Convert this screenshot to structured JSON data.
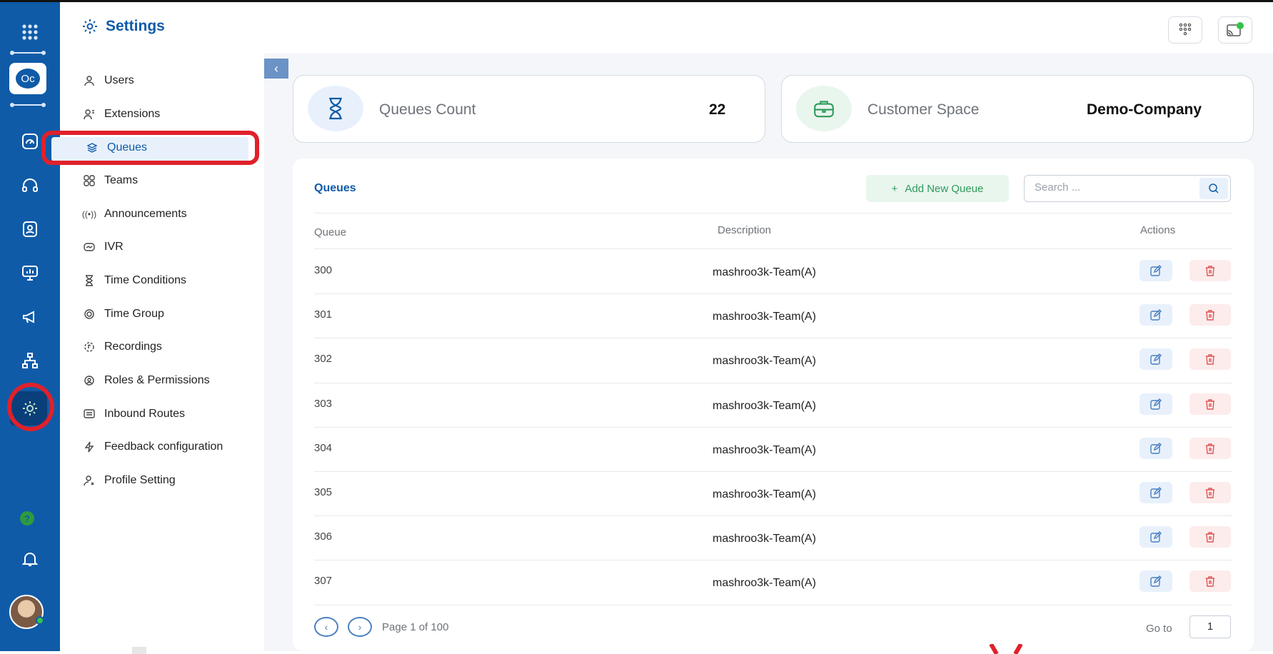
{
  "header": {
    "title": "Settings",
    "icon": "settings-cog-icon",
    "dialpad_icon": "dialpad-icon",
    "status_icon": "connection-status-icon",
    "status_color": "#35c24b"
  },
  "rail": {
    "logo_text": "Oc",
    "help_label": "?",
    "items": [
      "dashboard-icon",
      "headset-icon",
      "contacts-icon",
      "reports-icon",
      "campaign-icon",
      "org-chart-icon",
      "settings-icon"
    ],
    "accent": "#0f5ba8"
  },
  "sidebar": {
    "items": [
      {
        "label": "Users",
        "icon": "user-icon"
      },
      {
        "label": "Extensions",
        "icon": "extensions-icon"
      },
      {
        "label": "Queues",
        "icon": "layers-icon"
      },
      {
        "label": "Teams",
        "icon": "grid-icon"
      },
      {
        "label": "Announcements",
        "icon": "broadcast-icon"
      },
      {
        "label": "IVR",
        "icon": "ivr-icon"
      },
      {
        "label": "Time Conditions",
        "icon": "hourglass-icon"
      },
      {
        "label": "Time Group",
        "icon": "target-icon"
      },
      {
        "label": "Recordings",
        "icon": "recordings-icon"
      },
      {
        "label": "Roles & Permissions",
        "icon": "roles-icon"
      },
      {
        "label": "Inbound Routes",
        "icon": "inbound-icon"
      },
      {
        "label": "Feedback configuration",
        "icon": "feedback-icon"
      },
      {
        "label": "Profile Setting",
        "icon": "profile-setting-icon"
      }
    ],
    "active": "Queues"
  },
  "cards": {
    "queues_count": {
      "label": "Queues  Count",
      "value": "22",
      "icon": "hourglass-icon"
    },
    "customer_space": {
      "label": "Customer Space",
      "value": "Demo-Company",
      "icon": "briefcase-icon"
    }
  },
  "panel": {
    "title": "Queues",
    "add_button": "Add New Queue",
    "search_placeholder": "Search ...",
    "columns": {
      "queue": "Queue",
      "description": "Description",
      "actions": "Actions"
    },
    "rows": [
      {
        "queue": "300",
        "description": "mashroo3k-Team(A)"
      },
      {
        "queue": "301",
        "description": "mashroo3k-Team(A)"
      },
      {
        "queue": "302",
        "description": "mashroo3k-Team(A)"
      },
      {
        "queue": "303",
        "description": "mashroo3k-Team(A)"
      },
      {
        "queue": "304",
        "description": "mashroo3k-Team(A)"
      },
      {
        "queue": "305",
        "description": "mashroo3k-Team(A)"
      },
      {
        "queue": "306",
        "description": "mashroo3k-Team(A)"
      },
      {
        "queue": "307",
        "description": "mashroo3k-Team(A)"
      }
    ],
    "pager": {
      "text": "Page 1 of 100",
      "goto_label": "Go to",
      "goto_value": "1"
    }
  },
  "colors": {
    "edit": "#4a7fc0",
    "delete": "#e05555",
    "highlight": "#e0212b",
    "add_green": "#2e9a5b"
  }
}
